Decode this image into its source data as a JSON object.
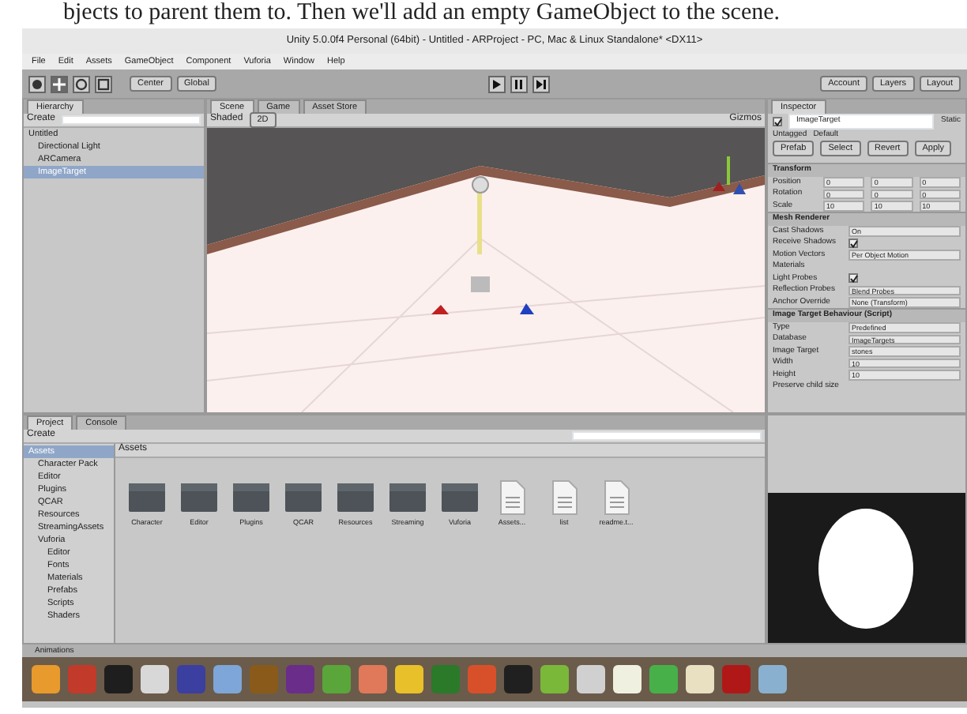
{
  "page_text": "bjects to parent them to. Then we'll add an empty GameObject to the scene.",
  "window": {
    "title": "Unity 5.0.0f4 Personal (64bit) - Untitled - ARProject - PC, Mac & Linux Standalone* <DX11>"
  },
  "menu": [
    "File",
    "Edit",
    "Assets",
    "GameObject",
    "Component",
    "Vuforia",
    "Window",
    "Help"
  ],
  "toolbar": {
    "tools": [
      {
        "kind": "hand",
        "selected": false
      },
      {
        "kind": "move",
        "selected": true
      },
      {
        "kind": "rotate",
        "selected": false
      },
      {
        "kind": "scale",
        "selected": false
      }
    ],
    "pivot": "Center",
    "space": "Global",
    "playback": [
      {
        "kind": "play"
      },
      {
        "kind": "pause"
      },
      {
        "kind": "step"
      }
    ],
    "right": [
      "Account",
      "Layers",
      "Layout"
    ]
  },
  "hierarchy": {
    "tab": "Hierarchy",
    "create": "Create",
    "items": [
      {
        "label": "Untitled",
        "selected": false,
        "children": [
          {
            "label": "Directional Light",
            "selected": false
          },
          {
            "label": "ARCamera",
            "selected": false
          },
          {
            "label": "ImageTarget",
            "selected": true
          }
        ]
      }
    ]
  },
  "scene": {
    "tabs": [
      {
        "label": "Scene",
        "selected": true
      },
      {
        "label": "Game",
        "selected": false
      },
      {
        "label": "Asset Store",
        "selected": false
      }
    ],
    "shading": "Shaded",
    "mode": "2D",
    "gizmos": "Gizmos"
  },
  "inspector": {
    "tab": "Inspector",
    "active": true,
    "object": "ImageTarget",
    "static": "Static",
    "tag": "Untagged",
    "layer": "Default",
    "prefab": [
      "Prefab",
      "Select",
      "Revert",
      "Apply"
    ],
    "rows": [
      {
        "kind": "header",
        "label": "Transform"
      },
      {
        "kind": "vec3",
        "label": "Position",
        "values": [
          "0",
          "0",
          "0"
        ]
      },
      {
        "kind": "vec3",
        "label": "Rotation",
        "values": [
          "0",
          "0",
          "0"
        ]
      },
      {
        "kind": "vec3",
        "label": "Scale",
        "values": [
          "10",
          "10",
          "10"
        ]
      },
      {
        "kind": "header",
        "label": "Mesh Renderer"
      },
      {
        "kind": "field",
        "label": "Cast Shadows",
        "value": "On"
      },
      {
        "kind": "check",
        "label": "Receive Shadows",
        "checked": true
      },
      {
        "kind": "field",
        "label": "Motion Vectors",
        "value": "Per Object Motion"
      },
      {
        "kind": "field",
        "label": "Materials",
        "value": ""
      },
      {
        "kind": "check",
        "label": "Light Probes",
        "checked": true
      },
      {
        "kind": "field",
        "label": "Reflection Probes",
        "value": "Blend Probes"
      },
      {
        "kind": "field",
        "label": "Anchor Override",
        "value": "None (Transform)"
      },
      {
        "kind": "header",
        "label": "Image Target Behaviour (Script)"
      },
      {
        "kind": "field",
        "label": "Type",
        "value": "Predefined"
      },
      {
        "kind": "field",
        "label": "Database",
        "value": "ImageTargets"
      },
      {
        "kind": "field",
        "label": "Image Target",
        "value": "stones"
      },
      {
        "kind": "field",
        "label": "Width",
        "value": "10"
      },
      {
        "kind": "field",
        "label": "Height",
        "value": "10"
      },
      {
        "kind": "field",
        "label": "Preserve child size",
        "value": ""
      }
    ]
  },
  "project": {
    "tabs": [
      {
        "label": "Project",
        "selected": true
      },
      {
        "label": "Console",
        "selected": false
      }
    ],
    "create": "Create",
    "breadcrumb": "Assets",
    "tree": [
      {
        "label": "Assets",
        "selected": true,
        "children": [
          {
            "label": "Character Pack",
            "selected": false
          },
          {
            "label": "Editor",
            "selected": false
          },
          {
            "label": "Plugins",
            "selected": false
          },
          {
            "label": "QCAR",
            "selected": false
          },
          {
            "label": "Resources",
            "selected": false
          },
          {
            "label": "StreamingAssets",
            "selected": false
          },
          {
            "label": "Vuforia",
            "selected": false,
            "children": [
              {
                "label": "Editor",
                "selected": false
              },
              {
                "label": "Fonts",
                "selected": false
              },
              {
                "label": "Materials",
                "selected": false
              },
              {
                "label": "Prefabs",
                "selected": false
              },
              {
                "label": "Scripts",
                "selected": false
              },
              {
                "label": "Shaders",
                "selected": false
              }
            ]
          }
        ]
      }
    ],
    "items": [
      {
        "kind": "folder",
        "label": "Character"
      },
      {
        "kind": "folder",
        "label": "Editor"
      },
      {
        "kind": "folder",
        "label": "Plugins"
      },
      {
        "kind": "folder",
        "label": "QCAR"
      },
      {
        "kind": "folder",
        "label": "Resources"
      },
      {
        "kind": "folder",
        "label": "Streaming"
      },
      {
        "kind": "folder",
        "label": "Vuforia"
      },
      {
        "kind": "file",
        "label": "Assets..."
      },
      {
        "kind": "file",
        "label": "list"
      },
      {
        "kind": "file",
        "label": "readme.t..."
      }
    ]
  },
  "console": {
    "label": "Animations"
  },
  "taskbar": [
    {
      "color": "#e89a2c"
    },
    {
      "color": "#c23a2a"
    },
    {
      "color": "#1e1e1e"
    },
    {
      "color": "#d8d8d8"
    },
    {
      "color": "#3b3fa0"
    },
    {
      "color": "#7ea6d8"
    },
    {
      "color": "#8a5a1a"
    },
    {
      "color": "#6a2d8a"
    },
    {
      "color": "#5aa63a"
    },
    {
      "color": "#e0785a"
    },
    {
      "color": "#e8c02a"
    },
    {
      "color": "#2a7a2a"
    },
    {
      "color": "#d8502a"
    },
    {
      "color": "#202020"
    },
    {
      "color": "#7ab83a"
    },
    {
      "color": "#d0d0d0"
    },
    {
      "color": "#f0f0e0"
    },
    {
      "color": "#48b048"
    },
    {
      "color": "#e8e0c0"
    },
    {
      "color": "#b01818"
    },
    {
      "color": "#8ab0d0"
    }
  ]
}
